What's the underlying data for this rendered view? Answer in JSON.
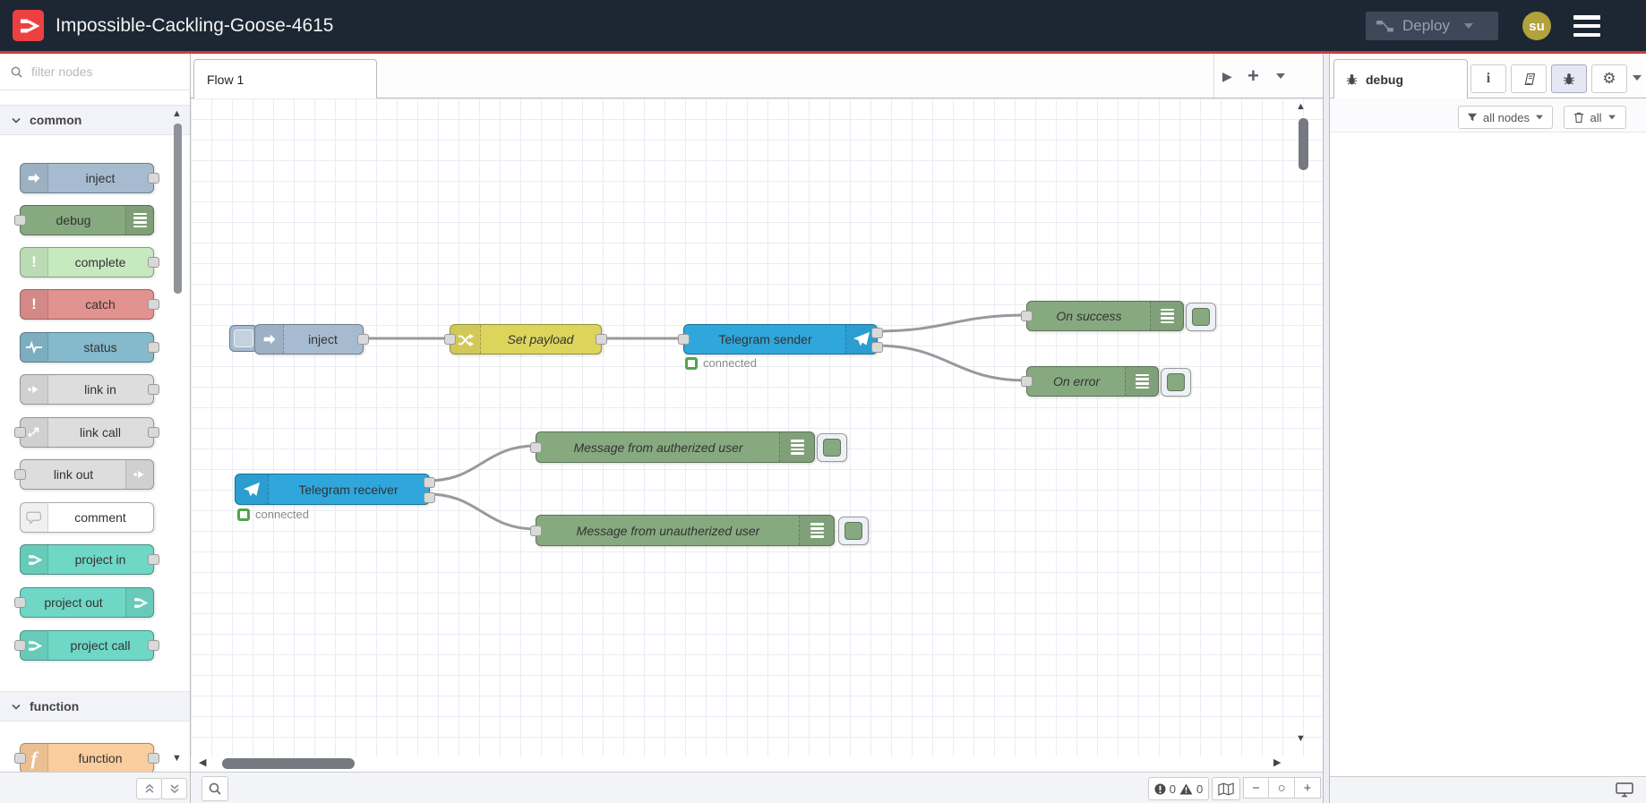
{
  "header": {
    "title": "Impossible-Cackling-Goose-4615",
    "deploy": {
      "label": "Deploy",
      "enabled": false
    },
    "avatar": {
      "text": "su",
      "color": "#b1a23b"
    },
    "colors": {
      "bar": "#1c2733",
      "accent_line": "#d03a3a",
      "logo": "#ee4040"
    }
  },
  "palette": {
    "filter_placeholder": "filter nodes",
    "categories": [
      {
        "label": "common"
      },
      {
        "label": "function"
      }
    ],
    "nodes": [
      {
        "label": "inject",
        "color": "#a6bbcf",
        "icon": "inject-arrow"
      },
      {
        "label": "debug",
        "color": "#87a980",
        "icon": "debug-list"
      },
      {
        "label": "complete",
        "color": "#c7e9c0",
        "icon": "exclamation"
      },
      {
        "label": "catch",
        "color": "#e2928f",
        "icon": "exclamation"
      },
      {
        "label": "status",
        "color": "#85b9cc",
        "icon": "pulse"
      },
      {
        "label": "link in",
        "color": "#dddddd",
        "icon": "link"
      },
      {
        "label": "link call",
        "color": "#dddddd",
        "icon": "link"
      },
      {
        "label": "link out",
        "color": "#dddddd",
        "icon": "link"
      },
      {
        "label": "comment",
        "color": "#ffffff",
        "icon": "speech-bubble"
      },
      {
        "label": "project in",
        "color": "#6fd7c5",
        "icon": "node-red-logo"
      },
      {
        "label": "project out",
        "color": "#6fd7c5",
        "icon": "node-red-logo"
      },
      {
        "label": "project call",
        "color": "#6fd7c5",
        "icon": "node-red-logo"
      },
      {
        "label": "function",
        "color": "#f9cd9d",
        "icon": "function-f"
      }
    ]
  },
  "workspace": {
    "tab": "Flow 1",
    "nodes": [
      {
        "label": "inject",
        "color": "#a6bbcf",
        "italic": false
      },
      {
        "label": "Set payload",
        "color": "#ddd45c",
        "italic": true
      },
      {
        "label": "Telegram sender",
        "color": "#2fa6dc",
        "italic": false,
        "status": "connected"
      },
      {
        "label": "On success",
        "color": "#87a980",
        "italic": true
      },
      {
        "label": "On error",
        "color": "#87a980",
        "italic": true
      },
      {
        "label": "Telegram receiver",
        "color": "#2fa6dc",
        "italic": false,
        "status": "connected"
      },
      {
        "label": "Message from autherized user",
        "color": "#87a980",
        "italic": true
      },
      {
        "label": "Message from unautherized user",
        "color": "#87a980",
        "italic": true
      }
    ],
    "wire_color": "#999999"
  },
  "sidebar": {
    "tab": "debug",
    "filter_button": "all nodes",
    "clear_button": "all"
  },
  "canvas_footer": {
    "error_count": "0",
    "warning_count": "0"
  }
}
